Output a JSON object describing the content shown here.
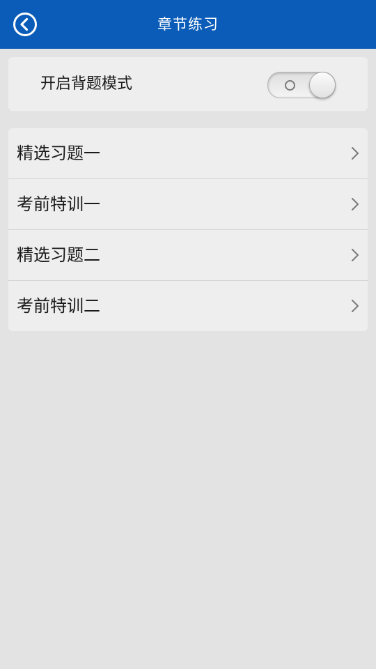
{
  "header": {
    "title": "章节练习",
    "back_icon": "back-arrow-circle-icon"
  },
  "recite_mode": {
    "label": "开启背题模式",
    "enabled": false
  },
  "chapters": [
    {
      "label": "精选习题一"
    },
    {
      "label": "考前特训一"
    },
    {
      "label": "精选习题二"
    },
    {
      "label": "考前特训二"
    }
  ],
  "colors": {
    "header_bg": "#0a5cb8",
    "page_bg": "#e3e3e3",
    "card_bg": "#eeeeee"
  }
}
